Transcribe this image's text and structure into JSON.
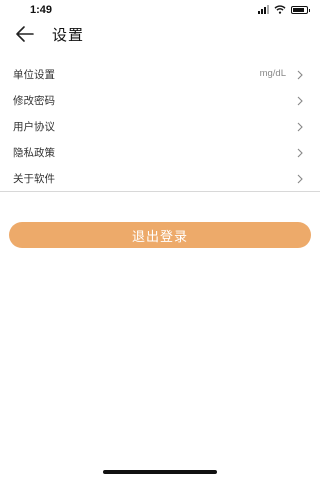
{
  "status_bar": {
    "time": "1:49",
    "icons": [
      "signal-icon",
      "wifi-icon",
      "battery-icon"
    ]
  },
  "header": {
    "title": "设置",
    "back_icon": "back-arrow-icon"
  },
  "settings": {
    "items": [
      {
        "label": "单位设置",
        "value": "mg/dL"
      },
      {
        "label": "修改密码",
        "value": ""
      },
      {
        "label": "用户协议",
        "value": ""
      },
      {
        "label": "隐私政策",
        "value": ""
      },
      {
        "label": "关于软件",
        "value": ""
      }
    ]
  },
  "logout": {
    "label": "退出登录"
  },
  "colors": {
    "accent": "#edaa6a",
    "text": "#333333",
    "muted": "#888888",
    "divider": "#d8d8d8"
  }
}
